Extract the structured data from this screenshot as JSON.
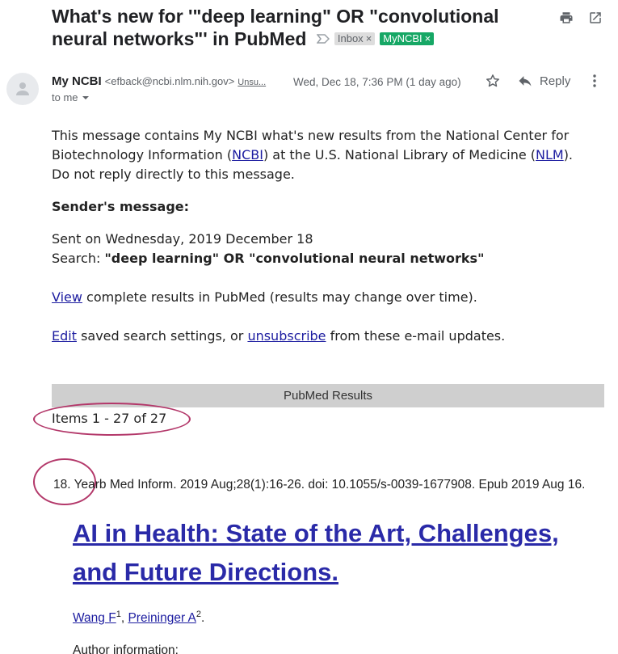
{
  "email": {
    "subject": "What's new for '\"deep learning\" OR \"convolutional neural networks\"' in PubMed",
    "labels": [
      {
        "name": "Inbox",
        "color": "#dddddd"
      },
      {
        "name": "MyNCBI",
        "color": "#16a765"
      }
    ],
    "sender_name": "My NCBI",
    "sender_email": "<efback@ncbi.nlm.nih.gov>",
    "unsubscribe_short": "Unsu...",
    "date": "Wed, Dec 18, 7:36 PM (1 day ago)",
    "recipient": "to me",
    "reply_label": "Reply",
    "icons": {
      "print": "printer-icon",
      "new_window": "open-in-new-icon",
      "star": "star-icon",
      "reply": "reply-icon",
      "more": "more-vertical-icon",
      "avatar": "person-icon"
    }
  },
  "body": {
    "intro_1": "This message contains My NCBI what's new results from the National Center for Biotechnology Information (",
    "ncbi_link": "NCBI",
    "intro_2": ") at the U.S. National Library of Medicine (",
    "nlm_link": "NLM",
    "intro_3": ").",
    "no_reply": "Do not reply directly to this message.",
    "sender_message_heading": "Sender's message:",
    "sent_on": "Sent on Wednesday, 2019 December 18",
    "search_label": "Search: ",
    "search_query": "\"deep learning\" OR \"convolutional neural networks\"",
    "view_link": "View",
    "view_text": " complete results in PubMed (results may change over time).",
    "edit_link": "Edit",
    "edit_text_1": " saved search settings, or ",
    "unsubscribe_link": "unsubscribe",
    "edit_text_2": " from these e-mail updates."
  },
  "results": {
    "header": "PubMed Results",
    "items_count": "Items 1 - 27 of 27",
    "article": {
      "citation": "18. Yearb Med Inform. 2019 Aug;28(1):16-26. doi: 10.1055/s-0039-1677908. Epub 2019 Aug 16.",
      "title": "AI in Health: State of the Art, Challenges, and Future Directions.",
      "author_1": "Wang F",
      "author_1_sup": "1",
      "author_sep": ", ",
      "author_2": "Preininger A",
      "author_2_sup": "2",
      "author_end": ".",
      "author_info": "Author information:"
    }
  },
  "annotation_color": "#b3386a"
}
